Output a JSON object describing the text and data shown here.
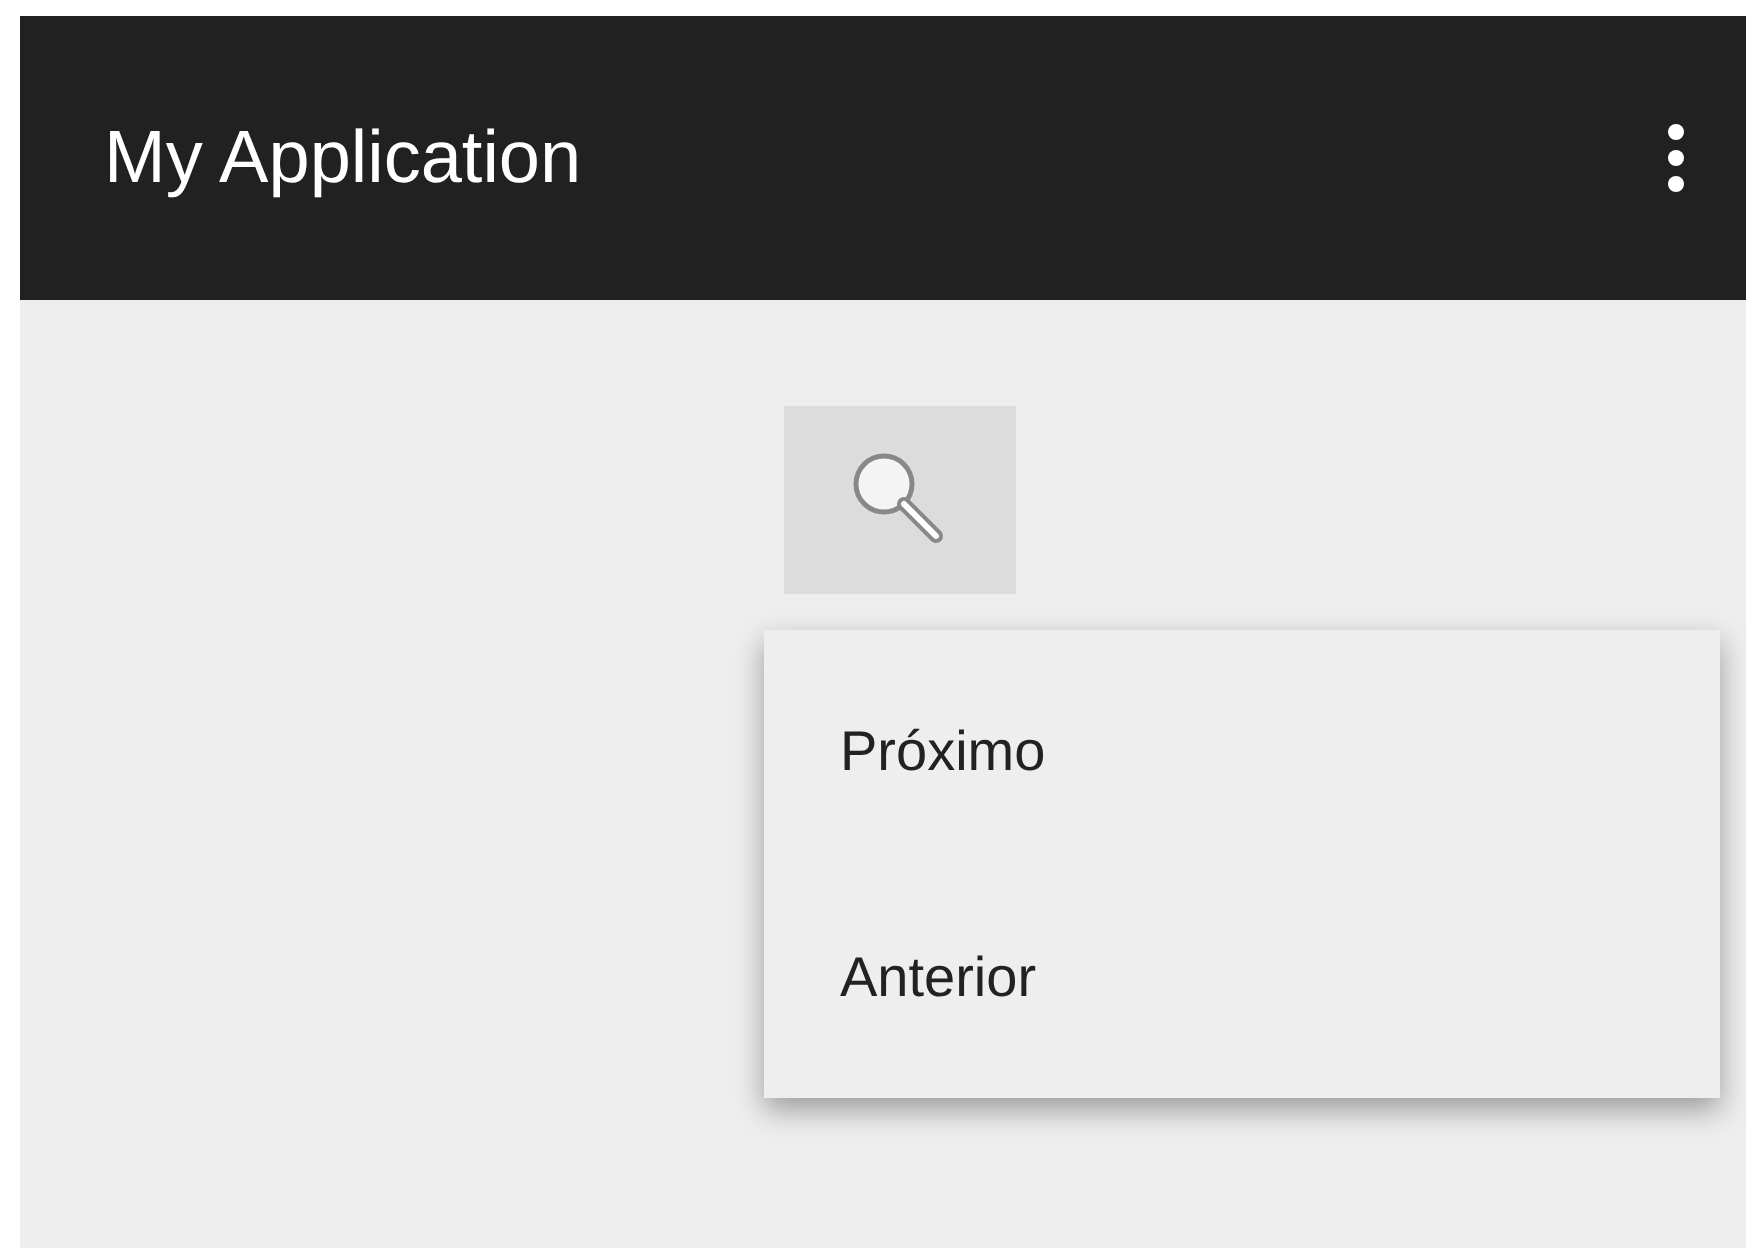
{
  "app_bar": {
    "title": "My Application"
  },
  "menu": {
    "items": [
      {
        "label": "Próximo"
      },
      {
        "label": "Anterior"
      }
    ]
  }
}
